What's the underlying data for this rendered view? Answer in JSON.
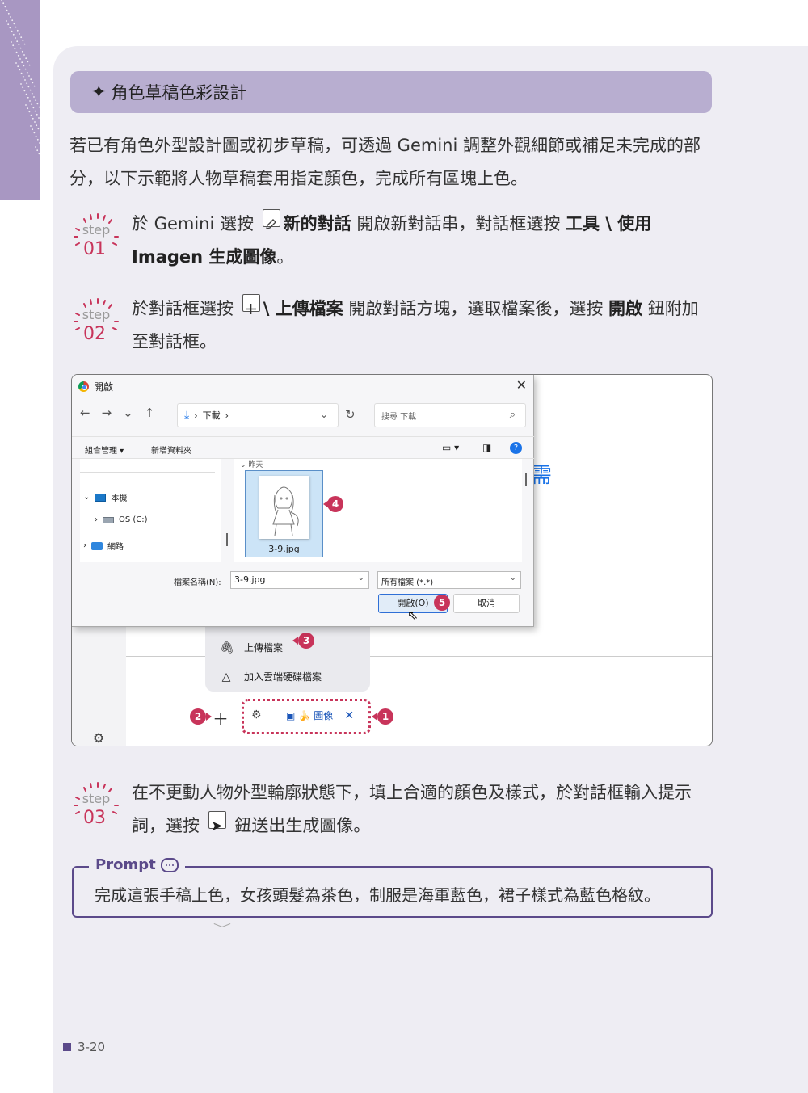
{
  "section_title": "角色草稿色彩設計",
  "intro_text": "若已有角色外型設計圖或初步草稿，可透過 Gemini 調整外觀細節或補足未完成的部分，以下示範將人物草稿套用指定顏色，完成所有區塊上色。",
  "steps": [
    {
      "label": "step",
      "number": "01",
      "t1": "於 Gemini 選按 ",
      "b1": "新的對話",
      "t2": " 開啟新對話串，對話框選按 ",
      "b2": "工具 \\ 使用 Imagen 生成圖像",
      "t3": "。"
    },
    {
      "label": "step",
      "number": "02",
      "t1": "於對話框選按 ",
      "b1": "\\ 上傳檔案",
      "t2": " 開啟對話方塊，選取檔案後，選按 ",
      "b2": "開啟",
      "t3": " 鈕附加至對話框。"
    },
    {
      "label": "step",
      "number": "03",
      "t1": "在不更動人物外型輪廓狀態下，填上合適的顏色及樣式，於對話框輸入提示詞，選按 ",
      "t2": " 鈕送出生成圖像。"
    }
  ],
  "screenshot": {
    "dialog_title": "開啟",
    "close_glyph": "✕",
    "nav": [
      "←",
      "→",
      "⌄",
      "↑"
    ],
    "address": "下載",
    "search_placeholder": "搜尋 下載",
    "toolbar_organize": "組合管理 ▾",
    "toolbar_new_folder": "新增資料夾",
    "tree": [
      "本機",
      "OS (C:)",
      "網路"
    ],
    "group_label": "昨天",
    "file_name": "3-9.jpg",
    "filename_label": "檔案名稱(N):",
    "filename_value": "3-9.jpg",
    "filetype_value": "所有檔案 (*.*)",
    "open_button": "開啟(O)",
    "cancel_button": "取消",
    "partial_heading": "需",
    "menu_upload": "上傳檔案",
    "menu_drive": "加入雲端硬碟檔案",
    "chip_label": "圖像",
    "badges": [
      "1",
      "2",
      "3",
      "4",
      "5"
    ]
  },
  "prompt": {
    "label": "Prompt",
    "text": "完成這張手稿上色，女孩頭髮為茶色，制服是海軍藍色，裙子樣式為藍色格紋。"
  },
  "page_number": "3-20",
  "colors": {
    "accent": "#b8aed0",
    "badge": "#c8345a",
    "prompt_border": "#5b4a8a",
    "panel_bg": "#eeedf3"
  }
}
